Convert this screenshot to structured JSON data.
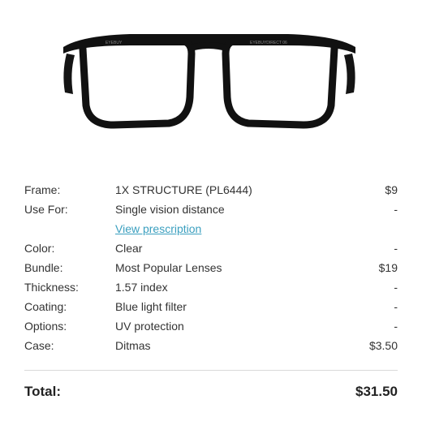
{
  "product": {
    "temple_text_left": "EYEBUY",
    "temple_text_right": "EYEBUYDIRECT 06",
    "frame_color": "#111111"
  },
  "rows": [
    {
      "label": "Frame:",
      "value": "1X STRUCTURE (PL6444)",
      "price": "$9"
    },
    {
      "label": "Use For:",
      "value": "Single vision distance",
      "price": "-"
    },
    {
      "link": "View prescription"
    },
    {
      "label": "Color:",
      "value": "Clear",
      "price": "-"
    },
    {
      "label": "Bundle:",
      "value": "Most Popular Lenses",
      "price": "$19"
    },
    {
      "label": "Thickness:",
      "value": "1.57 index",
      "price": "-"
    },
    {
      "label": "Coating:",
      "value": "Blue light filter",
      "price": "-"
    },
    {
      "label": "Options:",
      "value": "UV protection",
      "price": "-"
    },
    {
      "label": "Case:",
      "value": "Ditmas",
      "price": "$3.50"
    }
  ],
  "total": {
    "label": "Total:",
    "price": "$31.50"
  },
  "colors": {
    "link": "#3a9fbf",
    "divider": "#d9d9d9"
  }
}
